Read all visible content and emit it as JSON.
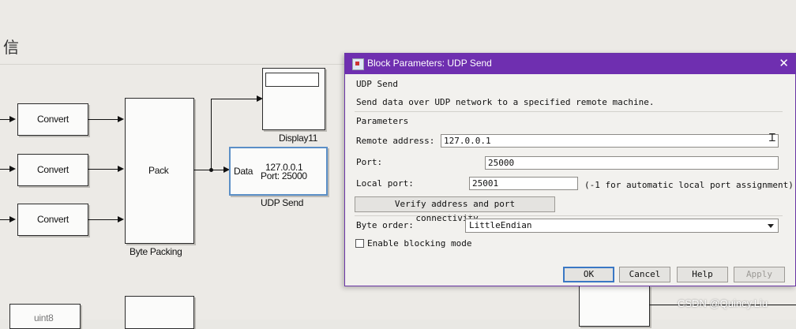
{
  "model": {
    "title_fragment": "信",
    "blocks": {
      "convert1": "Convert",
      "convert2": "Convert",
      "convert3": "Convert",
      "pack": "Pack",
      "pack_name": "Byte Packing",
      "display_name": "Display11",
      "udp_port_label": "Data",
      "udp_address": "127.0.0.1",
      "udp_port": "Port: 25000",
      "udp_name": "UDP Send",
      "partial_bottom": "uint8"
    }
  },
  "dialog": {
    "title": "Block Parameters: UDP Send",
    "block_type": "UDP Send",
    "description": "Send data over UDP network to a specified remote machine.",
    "section": "Parameters",
    "remote_address": {
      "label": "Remote address:",
      "value": "127.0.0.1"
    },
    "port": {
      "label": "Port:",
      "value": "25000"
    },
    "local_port": {
      "label": "Local port:",
      "value": "25001",
      "hint": "(-1 for automatic local port assignment)"
    },
    "verify_button": "Verify address and port connectivity...",
    "byte_order": {
      "label": "Byte order:",
      "value": "LittleEndian"
    },
    "blocking": {
      "label": "Enable blocking mode",
      "checked": false
    },
    "buttons": {
      "ok": "OK",
      "cancel": "Cancel",
      "help": "Help",
      "apply": "Apply"
    }
  },
  "watermark": "CSDN @Quincy.Liu",
  "colors": {
    "titlebar": "#6f2fb0",
    "ok_border": "#3b78c4"
  }
}
